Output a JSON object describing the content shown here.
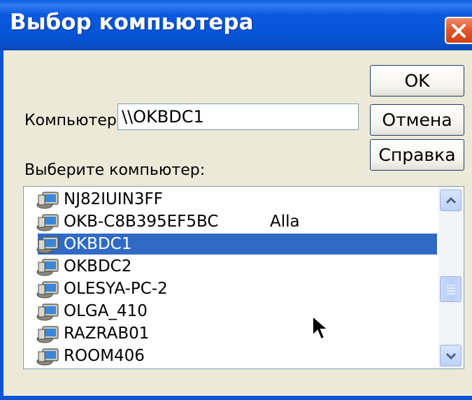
{
  "window": {
    "title": "Выбор компьютера"
  },
  "buttons": {
    "ok": "OK",
    "cancel": "Отмена",
    "help": "Справка"
  },
  "form": {
    "computer_label": "Компьютер:",
    "computer_value": "\\\\OKBDC1",
    "select_label": "Выберите компьютер:"
  },
  "list": {
    "items": [
      {
        "name": "NJ82IUIN3FF",
        "comment": ""
      },
      {
        "name": "OKB-C8B395EF5BC",
        "comment": "Alla"
      },
      {
        "name": "OKBDC1",
        "comment": "",
        "selected": true
      },
      {
        "name": "OKBDC2",
        "comment": ""
      },
      {
        "name": "OLESYA-PC-2",
        "comment": ""
      },
      {
        "name": "OLGA_410",
        "comment": ""
      },
      {
        "name": "RAZRAB01",
        "comment": ""
      },
      {
        "name": "ROOM406",
        "comment": ""
      }
    ],
    "icon": "computer-icon"
  },
  "colors": {
    "title_bar": "#0b58df",
    "selection": "#316ac5",
    "close_button": "#e2592f"
  }
}
